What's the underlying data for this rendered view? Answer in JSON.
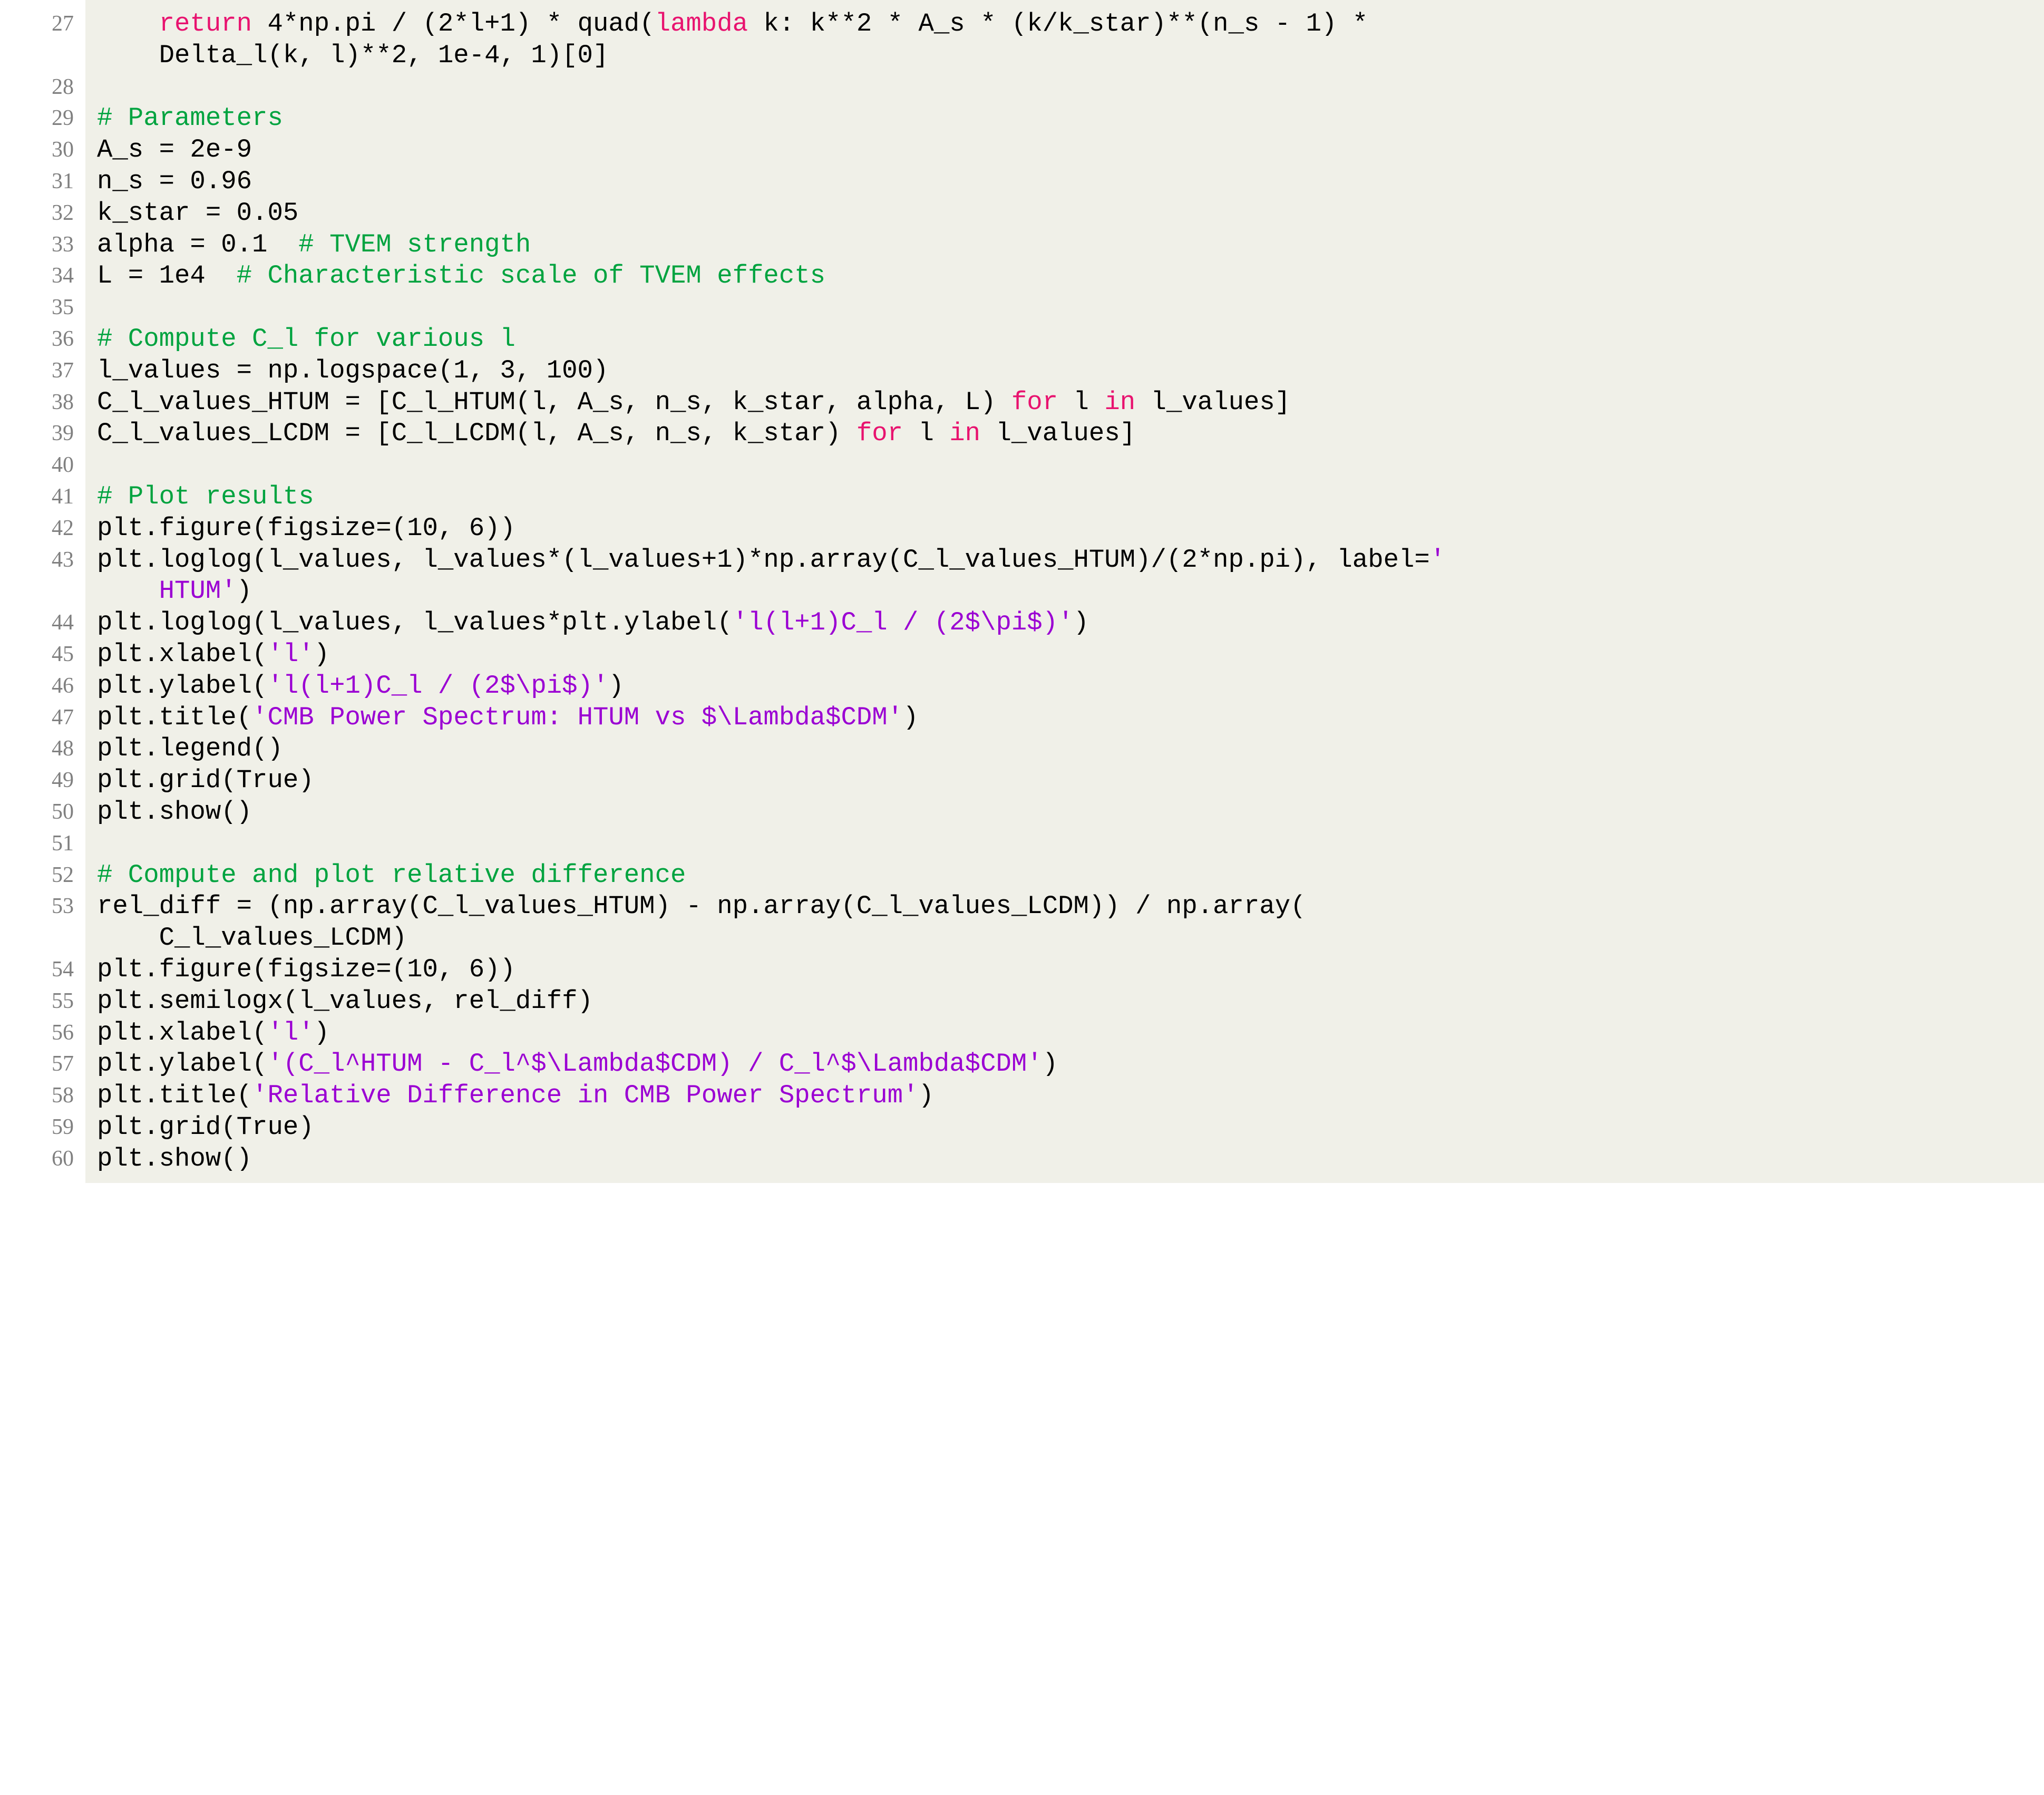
{
  "document": {
    "kind": "source-code-listing",
    "language": "python",
    "background_color": "#ffffff",
    "code_background_color": "#f0f0e8",
    "line_number_color": "#808080",
    "colors": {
      "keyword": "#e8136f",
      "comment": "#00a33f",
      "string": "#9b00d3",
      "plain": "#000000"
    }
  },
  "lines": [
    {
      "number": "27",
      "segments": [
        {
          "cls": "n",
          "text": "    "
        },
        {
          "cls": "k",
          "text": "return"
        },
        {
          "cls": "n",
          "text": " 4*np.pi / (2*l+1) * quad("
        },
        {
          "cls": "k",
          "text": "lambda"
        },
        {
          "cls": "n",
          "text": " k: k**2 * A_s * (k/k_star)**(n_s - 1) *"
        }
      ],
      "continuation": [
        {
          "cls": "n",
          "text": "    Delta_l(k, l)**2, 1e-4, 1)[0]"
        }
      ]
    },
    {
      "number": "28",
      "segments": [],
      "continuation": []
    },
    {
      "number": "29",
      "segments": [
        {
          "cls": "c",
          "text": "# Parameters"
        }
      ],
      "continuation": []
    },
    {
      "number": "30",
      "segments": [
        {
          "cls": "n",
          "text": "A_s = 2e-9"
        }
      ],
      "continuation": []
    },
    {
      "number": "31",
      "segments": [
        {
          "cls": "n",
          "text": "n_s = 0.96"
        }
      ],
      "continuation": []
    },
    {
      "number": "32",
      "segments": [
        {
          "cls": "n",
          "text": "k_star = 0.05"
        }
      ],
      "continuation": []
    },
    {
      "number": "33",
      "segments": [
        {
          "cls": "n",
          "text": "alpha = 0.1  "
        },
        {
          "cls": "c",
          "text": "# TVEM strength"
        }
      ],
      "continuation": []
    },
    {
      "number": "34",
      "segments": [
        {
          "cls": "n",
          "text": "L = 1e4  "
        },
        {
          "cls": "c",
          "text": "# Characteristic scale of TVEM effects"
        }
      ],
      "continuation": []
    },
    {
      "number": "35",
      "segments": [],
      "continuation": []
    },
    {
      "number": "36",
      "segments": [
        {
          "cls": "c",
          "text": "# Compute C_l for various l"
        }
      ],
      "continuation": []
    },
    {
      "number": "37",
      "segments": [
        {
          "cls": "n",
          "text": "l_values = np.logspace(1, 3, 100)"
        }
      ],
      "continuation": []
    },
    {
      "number": "38",
      "segments": [
        {
          "cls": "n",
          "text": "C_l_values_HTUM = [C_l_HTUM(l, A_s, n_s, k_star, alpha, L) "
        },
        {
          "cls": "k",
          "text": "for"
        },
        {
          "cls": "n",
          "text": " l "
        },
        {
          "cls": "k",
          "text": "in"
        },
        {
          "cls": "n",
          "text": " l_values]"
        }
      ],
      "continuation": []
    },
    {
      "number": "39",
      "segments": [
        {
          "cls": "n",
          "text": "C_l_values_LCDM = [C_l_LCDM(l, A_s, n_s, k_star) "
        },
        {
          "cls": "k",
          "text": "for"
        },
        {
          "cls": "n",
          "text": " l "
        },
        {
          "cls": "k",
          "text": "in"
        },
        {
          "cls": "n",
          "text": " l_values]"
        }
      ],
      "continuation": []
    },
    {
      "number": "40",
      "segments": [],
      "continuation": []
    },
    {
      "number": "41",
      "segments": [
        {
          "cls": "c",
          "text": "# Plot results"
        }
      ],
      "continuation": []
    },
    {
      "number": "42",
      "segments": [
        {
          "cls": "n",
          "text": "plt.figure(figsize=(10, 6))"
        }
      ],
      "continuation": []
    },
    {
      "number": "43",
      "segments": [
        {
          "cls": "n",
          "text": "plt.loglog(l_values, l_values*(l_values+1)*np.array(C_l_values_HTUM)/(2*np.pi), label="
        },
        {
          "cls": "s",
          "text": "'"
        }
      ],
      "continuation": [
        {
          "cls": "n",
          "text": "    "
        },
        {
          "cls": "s",
          "text": "HTUM'"
        },
        {
          "cls": "n",
          "text": ")"
        }
      ]
    },
    {
      "number": "44",
      "segments": [
        {
          "cls": "n",
          "text": "plt.loglog(l_values, l_values*plt.ylabel("
        },
        {
          "cls": "s",
          "text": "'l(l+1)C_l / (2$\\pi$)'"
        },
        {
          "cls": "n",
          "text": ")"
        }
      ],
      "continuation": []
    },
    {
      "number": "45",
      "segments": [
        {
          "cls": "n",
          "text": "plt.xlabel("
        },
        {
          "cls": "s",
          "text": "'l'"
        },
        {
          "cls": "n",
          "text": ")"
        }
      ],
      "continuation": []
    },
    {
      "number": "46",
      "segments": [
        {
          "cls": "n",
          "text": "plt.ylabel("
        },
        {
          "cls": "s",
          "text": "'l(l+1)C_l / (2$\\pi$)'"
        },
        {
          "cls": "n",
          "text": ")"
        }
      ],
      "continuation": []
    },
    {
      "number": "47",
      "segments": [
        {
          "cls": "n",
          "text": "plt.title("
        },
        {
          "cls": "s",
          "text": "'CMB Power Spectrum: HTUM vs $\\Lambda$CDM'"
        },
        {
          "cls": "n",
          "text": ")"
        }
      ],
      "continuation": []
    },
    {
      "number": "48",
      "segments": [
        {
          "cls": "n",
          "text": "plt.legend()"
        }
      ],
      "continuation": []
    },
    {
      "number": "49",
      "segments": [
        {
          "cls": "n",
          "text": "plt.grid(True)"
        }
      ],
      "continuation": []
    },
    {
      "number": "50",
      "segments": [
        {
          "cls": "n",
          "text": "plt.show()"
        }
      ],
      "continuation": []
    },
    {
      "number": "51",
      "segments": [],
      "continuation": []
    },
    {
      "number": "52",
      "segments": [
        {
          "cls": "c",
          "text": "# Compute and plot relative difference"
        }
      ],
      "continuation": []
    },
    {
      "number": "53",
      "segments": [
        {
          "cls": "n",
          "text": "rel_diff = (np.array(C_l_values_HTUM) - np.array(C_l_values_LCDM)) / np.array("
        }
      ],
      "continuation": [
        {
          "cls": "n",
          "text": "    C_l_values_LCDM)"
        }
      ]
    },
    {
      "number": "54",
      "segments": [
        {
          "cls": "n",
          "text": "plt.figure(figsize=(10, 6))"
        }
      ],
      "continuation": []
    },
    {
      "number": "55",
      "segments": [
        {
          "cls": "n",
          "text": "plt.semilogx(l_values, rel_diff)"
        }
      ],
      "continuation": []
    },
    {
      "number": "56",
      "segments": [
        {
          "cls": "n",
          "text": "plt.xlabel("
        },
        {
          "cls": "s",
          "text": "'l'"
        },
        {
          "cls": "n",
          "text": ")"
        }
      ],
      "continuation": []
    },
    {
      "number": "57",
      "segments": [
        {
          "cls": "n",
          "text": "plt.ylabel("
        },
        {
          "cls": "s",
          "text": "'(C_l^HTUM - C_l^$\\Lambda$CDM) / C_l^$\\Lambda$CDM'"
        },
        {
          "cls": "n",
          "text": ")"
        }
      ],
      "continuation": []
    },
    {
      "number": "58",
      "segments": [
        {
          "cls": "n",
          "text": "plt.title("
        },
        {
          "cls": "s",
          "text": "'Relative Difference in CMB Power Spectrum'"
        },
        {
          "cls": "n",
          "text": ")"
        }
      ],
      "continuation": []
    },
    {
      "number": "59",
      "segments": [
        {
          "cls": "n",
          "text": "plt.grid(True)"
        }
      ],
      "continuation": []
    },
    {
      "number": "60",
      "segments": [
        {
          "cls": "n",
          "text": "plt.show()"
        }
      ],
      "continuation": []
    }
  ]
}
